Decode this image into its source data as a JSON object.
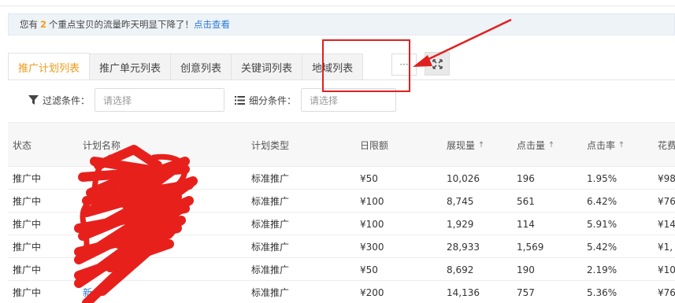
{
  "notice": {
    "prefix": "您有",
    "count": "2",
    "suffix": "个重点宝贝的流量昨天明显下降了！",
    "link": "点击查看"
  },
  "tabs": [
    {
      "label": "推广计划列表",
      "active": true
    },
    {
      "label": "推广单元列表",
      "active": false
    },
    {
      "label": "创意列表",
      "active": false
    },
    {
      "label": "关键词列表",
      "active": false
    },
    {
      "label": "地域列表",
      "active": false
    }
  ],
  "more_label": "···",
  "filters": {
    "filter_label": "过滤条件：",
    "filter_placeholder": "请选择",
    "segment_label": "细分条件：",
    "segment_placeholder": "请选择"
  },
  "table": {
    "headers": [
      "状态",
      "计划名称",
      "计划类型",
      "日限额",
      "展现量",
      "点击量",
      "点击率",
      "花费"
    ],
    "rows": [
      {
        "status": "推广中",
        "name": "",
        "type": "标准推广",
        "budget": "¥50",
        "impressions": "10,026",
        "clicks": "196",
        "ctr": "1.95%",
        "cost": "¥98"
      },
      {
        "status": "推广中",
        "name": "",
        "type": "标准推广",
        "budget": "¥100",
        "impressions": "8,745",
        "clicks": "561",
        "ctr": "6.42%",
        "cost": "¥76"
      },
      {
        "status": "推广中",
        "name": "",
        "type": "标准推广",
        "budget": "¥100",
        "impressions": "1,929",
        "clicks": "114",
        "ctr": "5.91%",
        "cost": "¥14"
      },
      {
        "status": "推广中",
        "name": "",
        "type": "标准推广",
        "budget": "¥300",
        "impressions": "28,933",
        "clicks": "1,569",
        "ctr": "5.42%",
        "cost": "¥1,"
      },
      {
        "status": "推广中",
        "name": "",
        "type": "标准推广",
        "budget": "¥50",
        "impressions": "8,692",
        "clicks": "190",
        "ctr": "2.19%",
        "cost": "¥10"
      },
      {
        "status": "推广中",
        "name": "新",
        "type": "标准推广",
        "budget": "¥200",
        "impressions": "14,136",
        "clicks": "757",
        "ctr": "5.36%",
        "cost": "¥76"
      }
    ]
  },
  "colors": {
    "accent": "#f09a1a",
    "link": "#2b7bd8",
    "annotation": "#e0201e"
  }
}
